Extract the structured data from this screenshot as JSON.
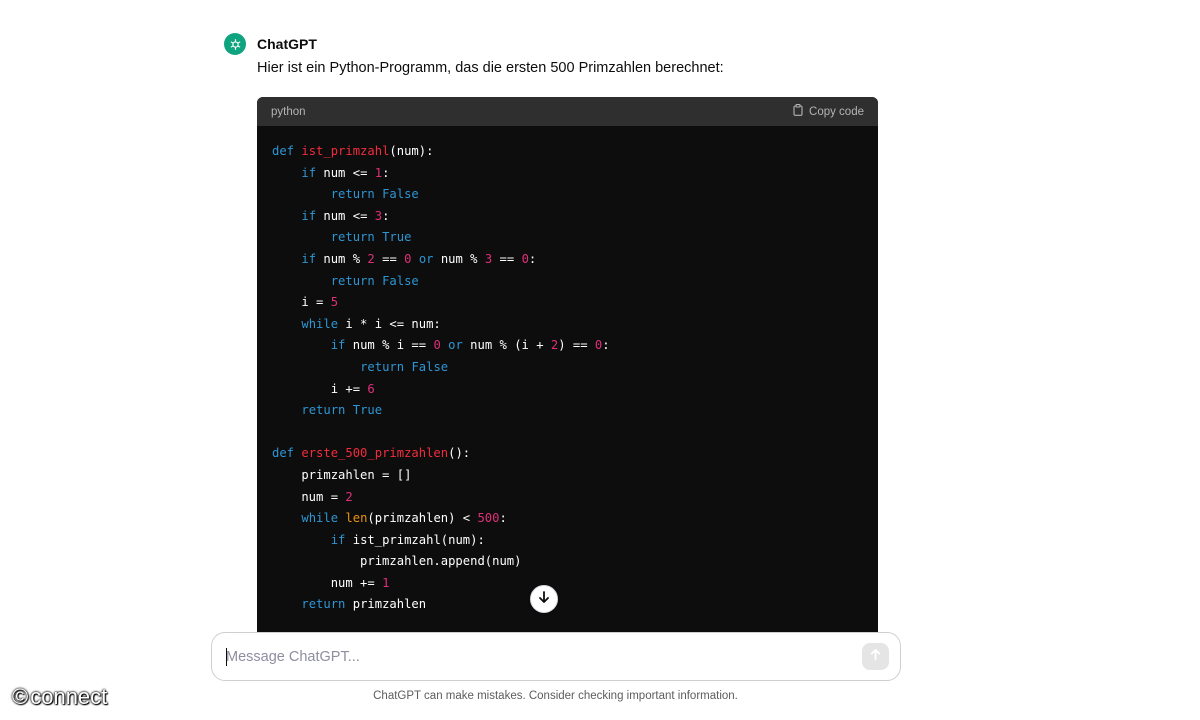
{
  "assistant": {
    "name": "ChatGPT",
    "intro": "Hier ist ein Python-Programm, das die ersten 500 Primzahlen berechnet:"
  },
  "code_block": {
    "language": "python",
    "copy_label": "Copy code",
    "lines": [
      [
        [
          "def",
          "kw"
        ],
        [
          " ",
          ""
        ],
        [
          "ist_primzahl",
          "fn"
        ],
        [
          "(num):",
          ""
        ]
      ],
      [
        [
          "    ",
          ""
        ],
        [
          "if",
          "kw"
        ],
        [
          " num <= ",
          ""
        ],
        [
          "1",
          "nm"
        ],
        [
          ":",
          ""
        ]
      ],
      [
        [
          "        ",
          ""
        ],
        [
          "return",
          "kw"
        ],
        [
          " ",
          ""
        ],
        [
          "False",
          "bl"
        ]
      ],
      [
        [
          "    ",
          ""
        ],
        [
          "if",
          "kw"
        ],
        [
          " num <= ",
          ""
        ],
        [
          "3",
          "nm"
        ],
        [
          ":",
          ""
        ]
      ],
      [
        [
          "        ",
          ""
        ],
        [
          "return",
          "kw"
        ],
        [
          " ",
          ""
        ],
        [
          "True",
          "bl"
        ]
      ],
      [
        [
          "    ",
          ""
        ],
        [
          "if",
          "kw"
        ],
        [
          " num % ",
          ""
        ],
        [
          "2",
          "nm"
        ],
        [
          " == ",
          ""
        ],
        [
          "0",
          "nm"
        ],
        [
          " ",
          ""
        ],
        [
          "or",
          "kw"
        ],
        [
          " num % ",
          ""
        ],
        [
          "3",
          "nm"
        ],
        [
          " == ",
          ""
        ],
        [
          "0",
          "nm"
        ],
        [
          ":",
          ""
        ]
      ],
      [
        [
          "        ",
          ""
        ],
        [
          "return",
          "kw"
        ],
        [
          " ",
          ""
        ],
        [
          "False",
          "bl"
        ]
      ],
      [
        [
          "    i = ",
          ""
        ],
        [
          "5",
          "nm"
        ]
      ],
      [
        [
          "    ",
          ""
        ],
        [
          "while",
          "kw"
        ],
        [
          " i * i <= num:",
          ""
        ]
      ],
      [
        [
          "        ",
          ""
        ],
        [
          "if",
          "kw"
        ],
        [
          " num % i == ",
          ""
        ],
        [
          "0",
          "nm"
        ],
        [
          " ",
          ""
        ],
        [
          "or",
          "kw"
        ],
        [
          " num % (i + ",
          ""
        ],
        [
          "2",
          "nm"
        ],
        [
          ") == ",
          ""
        ],
        [
          "0",
          "nm"
        ],
        [
          ":",
          ""
        ]
      ],
      [
        [
          "            ",
          ""
        ],
        [
          "return",
          "kw"
        ],
        [
          " ",
          ""
        ],
        [
          "False",
          "bl"
        ]
      ],
      [
        [
          "        i += ",
          ""
        ],
        [
          "6",
          "nm"
        ]
      ],
      [
        [
          "    ",
          ""
        ],
        [
          "return",
          "kw"
        ],
        [
          " ",
          ""
        ],
        [
          "True",
          "bl"
        ]
      ],
      [],
      [
        [
          "def",
          "kw"
        ],
        [
          " ",
          ""
        ],
        [
          "erste_500_primzahlen",
          "fn"
        ],
        [
          "():",
          ""
        ]
      ],
      [
        [
          "    primzahlen = []",
          ""
        ]
      ],
      [
        [
          "    num = ",
          ""
        ],
        [
          "2",
          "nm"
        ]
      ],
      [
        [
          "    ",
          ""
        ],
        [
          "while",
          "kw"
        ],
        [
          " ",
          ""
        ],
        [
          "len",
          "bi"
        ],
        [
          "(primzahlen) < ",
          ""
        ],
        [
          "500",
          "nm"
        ],
        [
          ":",
          ""
        ]
      ],
      [
        [
          "        ",
          ""
        ],
        [
          "if",
          "kw"
        ],
        [
          " ist_primzahl(num):",
          ""
        ]
      ],
      [
        [
          "            primzahlen.append(num)",
          ""
        ]
      ],
      [
        [
          "        num += ",
          ""
        ],
        [
          "1",
          "nm"
        ]
      ],
      [
        [
          "    ",
          ""
        ],
        [
          "return",
          "kw"
        ],
        [
          " primzahlen",
          ""
        ]
      ]
    ]
  },
  "composer": {
    "placeholder": "Message ChatGPT...",
    "value": ""
  },
  "disclaimer": "ChatGPT can make mistakes. Consider checking important information.",
  "watermark": {
    "symbol": "©",
    "text": "connect"
  },
  "colors": {
    "brand": "#10a37f",
    "code_bg": "#0d0d0d",
    "code_header_bg": "#2f2f2f",
    "keyword": "#2e95d3",
    "function": "#f22c3d",
    "number": "#df3079",
    "builtin": "#e9950c"
  },
  "icons": {
    "assistant": "openai-logo-icon",
    "copy": "clipboard-icon",
    "scroll": "arrow-down-icon",
    "send": "arrow-up-icon"
  }
}
